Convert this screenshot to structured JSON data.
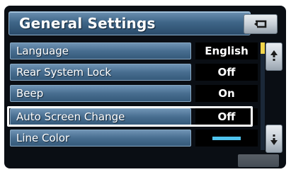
{
  "header": {
    "title": "General Settings",
    "back_icon": "return-arrow-icon"
  },
  "rows": [
    {
      "label": "Language",
      "value": "English"
    },
    {
      "label": "Rear System Lock",
      "value": "Off"
    },
    {
      "label": "Beep",
      "value": "On"
    },
    {
      "label": "Auto Screen Change",
      "value": "Off"
    },
    {
      "label": "Line Color",
      "value_color": "#4fc3ee"
    }
  ],
  "scroll": {
    "up_icon": "scroll-up-arrow-icon",
    "down_icon": "scroll-down-arrow-icon",
    "thumb_color": "#f2d54a"
  },
  "colors": {
    "header_blue": "#3f6688",
    "button_blue": "#486e90",
    "value_bg": "#000000",
    "screen_bg": "#0a0e14"
  },
  "selected_row": "Auto Screen Change"
}
